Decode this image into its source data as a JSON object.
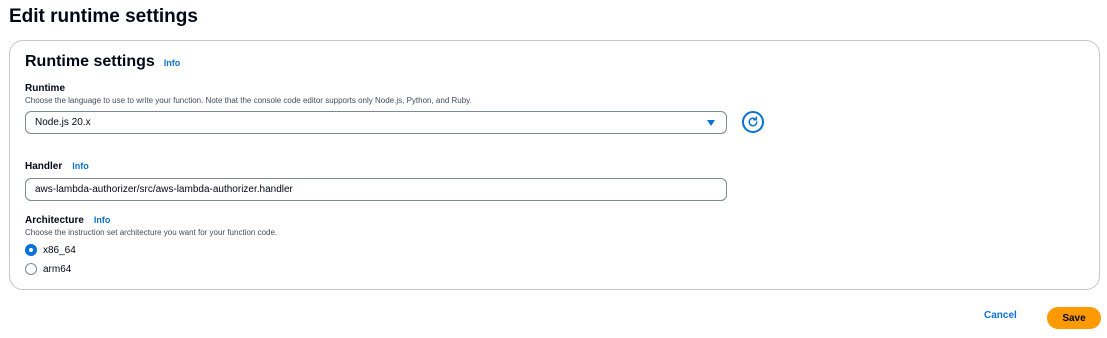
{
  "page": {
    "title": "Edit runtime settings"
  },
  "panel": {
    "title": "Runtime settings",
    "info": "Info"
  },
  "runtime": {
    "label": "Runtime",
    "description": "Choose the language to use to write your function. Note that the console code editor supports only Node.js, Python, and Ruby.",
    "selected": "Node.js 20.x"
  },
  "handler": {
    "label": "Handler",
    "info": "Info",
    "value": "aws-lambda-authorizer/src/aws-lambda-authorizer.handler"
  },
  "architecture": {
    "label": "Architecture",
    "info": "Info",
    "description": "Choose the instruction set architecture you want for your function code.",
    "options": [
      {
        "label": "x86_64",
        "checked": true
      },
      {
        "label": "arm64",
        "checked": false
      }
    ]
  },
  "actions": {
    "cancel": "Cancel",
    "save": "Save"
  },
  "colors": {
    "accent": "#0972d3",
    "primary_button": "#ff9900"
  }
}
